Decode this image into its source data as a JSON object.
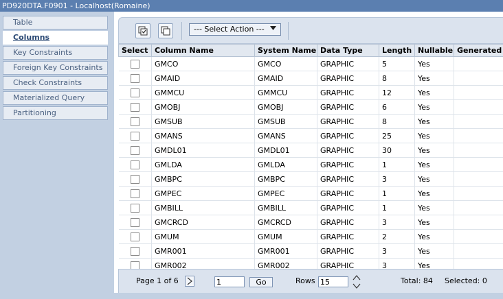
{
  "window": {
    "title": "PD920DTA.F0901 - Localhost(Romaine)"
  },
  "sidebar": {
    "items": [
      {
        "label": "Table"
      },
      {
        "label": "Columns"
      },
      {
        "label": "Key Constraints"
      },
      {
        "label": "Foreign Key Constraints"
      },
      {
        "label": "Check Constraints"
      },
      {
        "label": "Materialized Query"
      },
      {
        "label": "Partitioning"
      }
    ]
  },
  "toolbar": {
    "action_select": "--- Select Action ---"
  },
  "table": {
    "headers": [
      "Select",
      "Column Name",
      "System Name",
      "Data Type",
      "Length",
      "Nullable",
      "Generated Value"
    ],
    "rows": [
      [
        "GMCO",
        "GMCO",
        "GRAPHIC",
        "5",
        "Yes"
      ],
      [
        "GMAID",
        "GMAID",
        "GRAPHIC",
        "8",
        "Yes"
      ],
      [
        "GMMCU",
        "GMMCU",
        "GRAPHIC",
        "12",
        "Yes"
      ],
      [
        "GMOBJ",
        "GMOBJ",
        "GRAPHIC",
        "6",
        "Yes"
      ],
      [
        "GMSUB",
        "GMSUB",
        "GRAPHIC",
        "8",
        "Yes"
      ],
      [
        "GMANS",
        "GMANS",
        "GRAPHIC",
        "25",
        "Yes"
      ],
      [
        "GMDL01",
        "GMDL01",
        "GRAPHIC",
        "30",
        "Yes"
      ],
      [
        "GMLDA",
        "GMLDA",
        "GRAPHIC",
        "1",
        "Yes"
      ],
      [
        "GMBPC",
        "GMBPC",
        "GRAPHIC",
        "3",
        "Yes"
      ],
      [
        "GMPEC",
        "GMPEC",
        "GRAPHIC",
        "1",
        "Yes"
      ],
      [
        "GMBILL",
        "GMBILL",
        "GRAPHIC",
        "1",
        "Yes"
      ],
      [
        "GMCRCD",
        "GMCRCD",
        "GRAPHIC",
        "3",
        "Yes"
      ],
      [
        "GMUM",
        "GMUM",
        "GRAPHIC",
        "2",
        "Yes"
      ],
      [
        "GMR001",
        "GMR001",
        "GRAPHIC",
        "3",
        "Yes"
      ],
      [
        "GMR002",
        "GMR002",
        "GRAPHIC",
        "3",
        "Yes"
      ]
    ]
  },
  "pager": {
    "page_label": "Page 1 of 6",
    "page_value": "1",
    "go_label": "Go",
    "rows_label": "Rows",
    "rows_value": "15",
    "total": "Total: 84",
    "selected": "Selected: 0"
  }
}
